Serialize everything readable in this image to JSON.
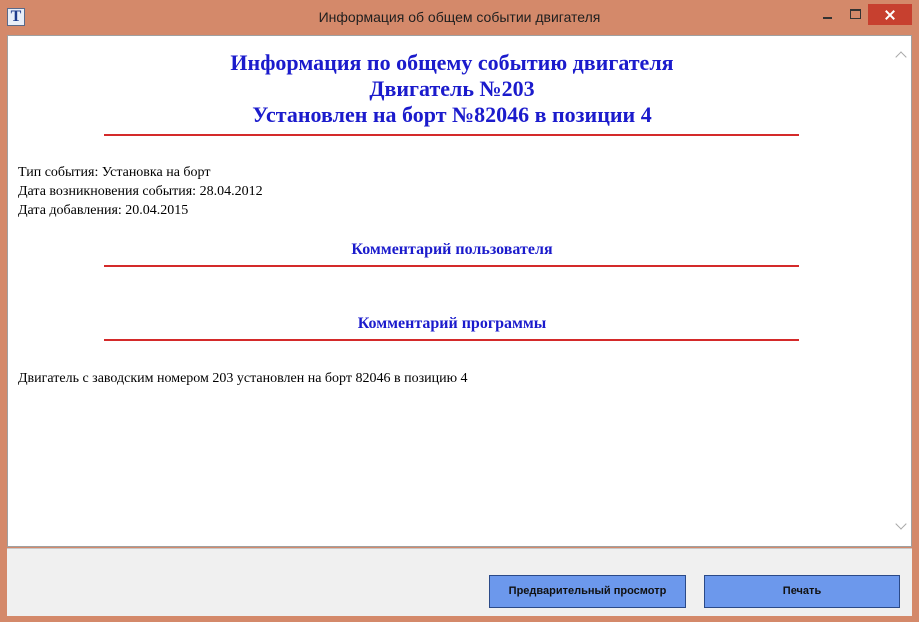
{
  "window": {
    "title": "Информация об общем событии двигателя",
    "icon_letter": "T"
  },
  "report": {
    "heading_line1": "Информация по общему событию двигателя",
    "heading_line2": "Двигатель №203",
    "heading_line3": "Установлен на борт №82046 в позиции 4",
    "event_type": "Тип события: Установка на борт",
    "event_date": "Дата возникновения события: 28.04.2012",
    "added_date": "Дата добавления: 20.04.2015",
    "user_comment_heading": "Комментарий пользователя",
    "program_comment_heading": "Комментарий программы",
    "program_comment_text": "Двигатель с заводским номером 203 установлен на борт 82046 в позицию 4"
  },
  "footer": {
    "preview_label": "Предварительный просмотр",
    "print_label": "Печать"
  },
  "colors": {
    "heading": "#1b1bcc",
    "divider": "#d42a2a",
    "titlebar": "#d4896a",
    "button": "#6c98ec",
    "close": "#c7402f"
  }
}
